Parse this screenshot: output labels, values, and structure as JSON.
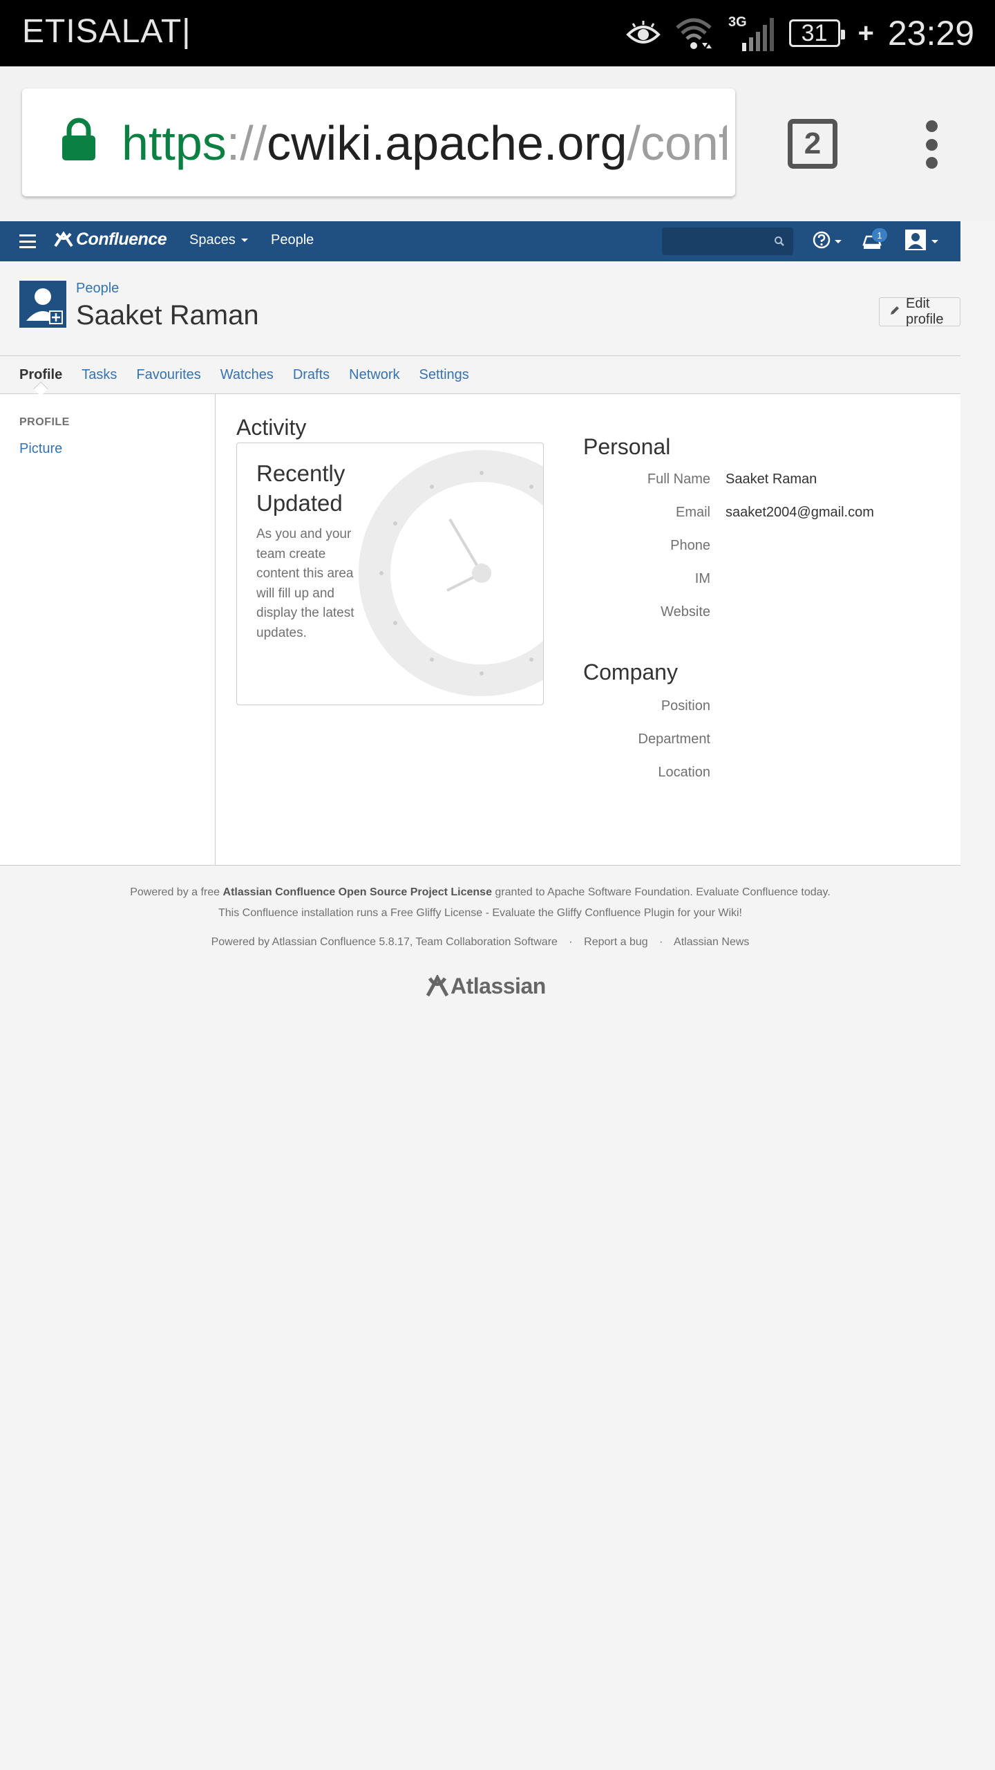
{
  "status_bar": {
    "carrier": "ETISALAT|",
    "network": "3G",
    "battery": "31",
    "time": "23:29",
    "icons": [
      "eye-icon",
      "wifi-icon",
      "signal-icon",
      "battery-icon",
      "charging-icon"
    ]
  },
  "browser": {
    "url_scheme": "https",
    "url_sep": "://",
    "url_host": "cwiki.apache.org",
    "url_path": "/confl",
    "tab_count": "2",
    "colors": {
      "scheme": "#0b8043",
      "lock": "#0b8043"
    }
  },
  "header": {
    "logo": "Confluence",
    "nav_spaces": "Spaces",
    "nav_people": "People",
    "notification_count": "1",
    "color": "#205081"
  },
  "page": {
    "breadcrumb": "People",
    "title": "Saaket Raman",
    "edit_button": "Edit profile"
  },
  "tabs": [
    "Profile",
    "Tasks",
    "Favourites",
    "Watches",
    "Drafts",
    "Network",
    "Settings"
  ],
  "active_tab": "Profile",
  "sidebar": {
    "heading": "PROFILE",
    "link": "Picture"
  },
  "activity": {
    "title": "Activity",
    "card_title": "Recently Updated",
    "card_desc": "As you and your team create content this area will fill up and display the latest updates."
  },
  "personal": {
    "title": "Personal",
    "fields": [
      {
        "label": "Full Name",
        "value": "Saaket Raman"
      },
      {
        "label": "Email",
        "value": "saaket2004@gmail.com"
      },
      {
        "label": "Phone",
        "value": ""
      },
      {
        "label": "IM",
        "value": ""
      },
      {
        "label": "Website",
        "value": ""
      }
    ]
  },
  "company": {
    "title": "Company",
    "fields": [
      {
        "label": "Position",
        "value": ""
      },
      {
        "label": "Department",
        "value": ""
      },
      {
        "label": "Location",
        "value": ""
      }
    ]
  },
  "footer": {
    "line1_pre": "Powered by a free",
    "line1_bold": "Atlassian Confluence Open Source Project License",
    "line1_post": "granted to Apache Software Foundation. Evaluate Confluence today.",
    "line2": "This Confluence installation runs a Free Gliffy License - Evaluate the Gliffy Confluence Plugin for your Wiki!",
    "powered": "Powered by Atlassian Confluence 5.8.17, Team Collaboration Software",
    "sep": "·",
    "report_bug": "Report a bug",
    "news": "Atlassian News",
    "logo": "Atlassian"
  }
}
